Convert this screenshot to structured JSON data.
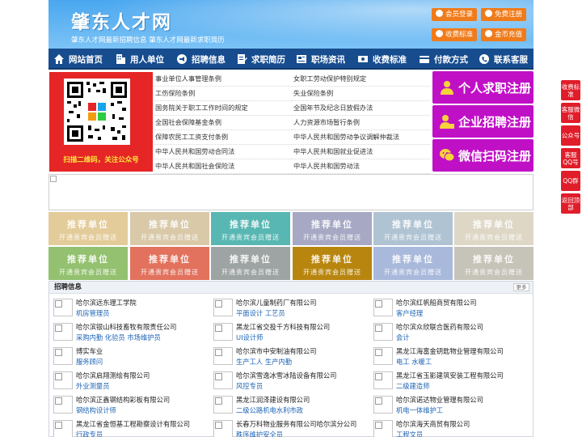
{
  "header": {
    "logo": "肇东人才网",
    "slogan": "肇东人才网最新招聘信息   肇东人才网最新求职简历",
    "buttons": [
      "会员登录",
      "免费注册",
      "收费标准",
      "金币充值"
    ]
  },
  "nav": {
    "items": [
      {
        "label": "网站首页",
        "icon": "home-icon"
      },
      {
        "label": "用人单位",
        "icon": "building-icon"
      },
      {
        "label": "招聘信息",
        "icon": "megaphone-icon"
      },
      {
        "label": "求职简历",
        "icon": "resume-icon"
      },
      {
        "label": "职场资讯",
        "icon": "news-icon"
      },
      {
        "label": "收费标准",
        "icon": "money-icon"
      },
      {
        "label": "付款方式",
        "icon": "card-icon"
      },
      {
        "label": "联系客服",
        "icon": "phone-icon"
      }
    ]
  },
  "qr": {
    "caption": "扫描二维码，关注公众号"
  },
  "policy_links": [
    [
      "事业单位人事管理条例",
      "女职工劳动保护特别规定"
    ],
    [
      "工伤保险条例",
      "失业保险条例"
    ],
    [
      "国务院关于职工工作时间的规定",
      "全国年节及纪念日放假办法"
    ],
    [
      "全国社会保障基金条例",
      "人力资源市场暂行条例"
    ],
    [
      "保障农民工工资支付条例",
      "中华人民共和国劳动争议调解仲裁法"
    ],
    [
      "中华人民共和国劳动合同法",
      "中华人民共和国就业促进法"
    ],
    [
      "中华人民共和国社会保险法",
      "中华人民共和国劳动法"
    ]
  ],
  "register": [
    {
      "label": "个人求职注册",
      "icon": "person-icon"
    },
    {
      "label": "企业招聘注册",
      "icon": "company-icon"
    },
    {
      "label": "微信扫码注册",
      "icon": "wechat-icon"
    }
  ],
  "tiles": {
    "title": "推荐单位",
    "subtitle": "开通贵宾会员赠送",
    "colors": [
      "#e3cc9a",
      "#d9c9a9",
      "#59b7b3",
      "#a7a8c4",
      "#afc3d3",
      "#ded7c6",
      "#93c16f",
      "#e2725d",
      "#9ea4a3",
      "#b8860f",
      "#a9b9db",
      "#c6c3b8"
    ]
  },
  "recruit": {
    "title": "招聘信息",
    "more": "更多",
    "jobs": [
      {
        "company": "哈尔滨远东理工学院",
        "positions": "机房管理员"
      },
      {
        "company": "哈尔滨儿童制药厂有限公司",
        "positions": "平面设计 工艺员"
      },
      {
        "company": "哈尔滨红帆船商贸有限公司",
        "positions": "客户经理"
      },
      {
        "company": "哈尔滨银山科技畜牧有限责任公司",
        "positions": "采购内勤 化验员 市场维护员"
      },
      {
        "company": "黑龙江省交投千方科技有限公司",
        "positions": "UI设计师"
      },
      {
        "company": "哈尔滨众欣联合医药有限公司",
        "positions": "会计"
      },
      {
        "company": "博实车业",
        "positions": "服务顾问"
      },
      {
        "company": "哈尔滨市中安制油有限公司",
        "positions": "生产工人 生产内勤"
      },
      {
        "company": "黑龙江海富金钥匙物业管理有限公司",
        "positions": "电工 水暖工"
      },
      {
        "company": "哈尔滨启翔测绘有限公司",
        "positions": "外业测量员"
      },
      {
        "company": "哈尔滨雪逸冰雪冰陆设备有限公司",
        "positions": "风控专员"
      },
      {
        "company": "黑龙江省玉影建筑安装工程有限公司",
        "positions": "二级建造师"
      },
      {
        "company": "哈尔滨正鑫钢结构彩板有限公司",
        "positions": "钢结构设计师"
      },
      {
        "company": "黑龙江润泽建设有限公司",
        "positions": "二级公路机电水利市政"
      },
      {
        "company": "哈尔滨诺达物业管理有限公司",
        "positions": "机电一体维护工"
      },
      {
        "company": "黑龙江省金恒基工程勘察设计有限公司",
        "positions": "行政专员"
      },
      {
        "company": "长春万科物业服务有限公司哈尔滨分公司",
        "positions": "秩序维护安全员"
      },
      {
        "company": "哈尔滨海天商贸有限公司",
        "positions": "工程文员"
      }
    ]
  },
  "float": [
    "收费标准",
    "客服微信",
    "公众号",
    "客服QQ号",
    "QQ群",
    "返回顶部"
  ]
}
